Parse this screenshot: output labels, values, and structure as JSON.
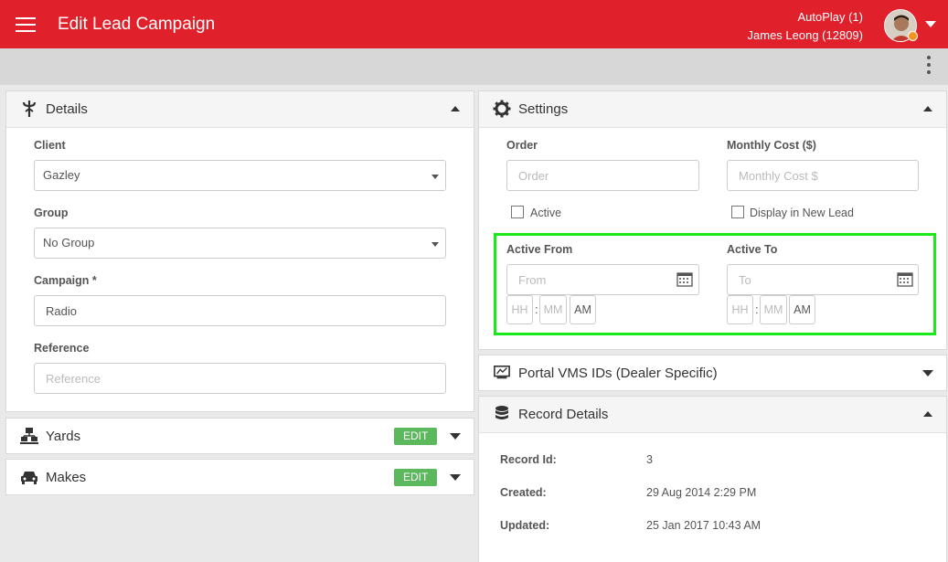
{
  "header": {
    "title": "Edit Lead Campaign",
    "account_line": "AutoPlay (1)",
    "user_line": "James Leong (12809)"
  },
  "details": {
    "title": "Details",
    "client_label": "Client",
    "client_value": "Gazley",
    "group_label": "Group",
    "group_value": "No Group",
    "campaign_label": "Campaign *",
    "campaign_value": "Radio",
    "reference_label": "Reference",
    "reference_placeholder": "Reference"
  },
  "yards": {
    "title": "Yards",
    "edit_label": "EDIT"
  },
  "makes": {
    "title": "Makes",
    "edit_label": "EDIT"
  },
  "settings": {
    "title": "Settings",
    "order_label": "Order",
    "order_placeholder": "Order",
    "monthly_cost_label": "Monthly Cost ($)",
    "monthly_cost_placeholder": "Monthly Cost $",
    "active_label": "Active",
    "display_new_lead_label": "Display in New Lead",
    "active_from_label": "Active From",
    "active_from_placeholder": "From",
    "active_to_label": "Active To",
    "active_to_placeholder": "To",
    "hh_placeholder": "HH",
    "mm_placeholder": "MM",
    "ampm": "AM",
    "time_sep": ":"
  },
  "portal": {
    "title": "Portal VMS IDs (Dealer Specific)"
  },
  "record": {
    "title": "Record Details",
    "id_label": "Record Id:",
    "id_value": "3",
    "created_label": "Created:",
    "created_value": "29 Aug 2014 2:29 PM",
    "updated_label": "Updated:",
    "updated_value": "25 Jan 2017 10:43 AM"
  },
  "colors": {
    "header_bg": "#e0202a",
    "edit_button": "#5cb85c",
    "highlight": "#19e819",
    "status_dot": "#f7941d"
  },
  "icons": [
    "menu-icon",
    "chevron-down-icon",
    "kebab-menu-icon",
    "funnel-icon",
    "gear-icon",
    "yards-icon",
    "car-icon",
    "calendar-icon",
    "monitor-icon",
    "database-icon"
  ]
}
